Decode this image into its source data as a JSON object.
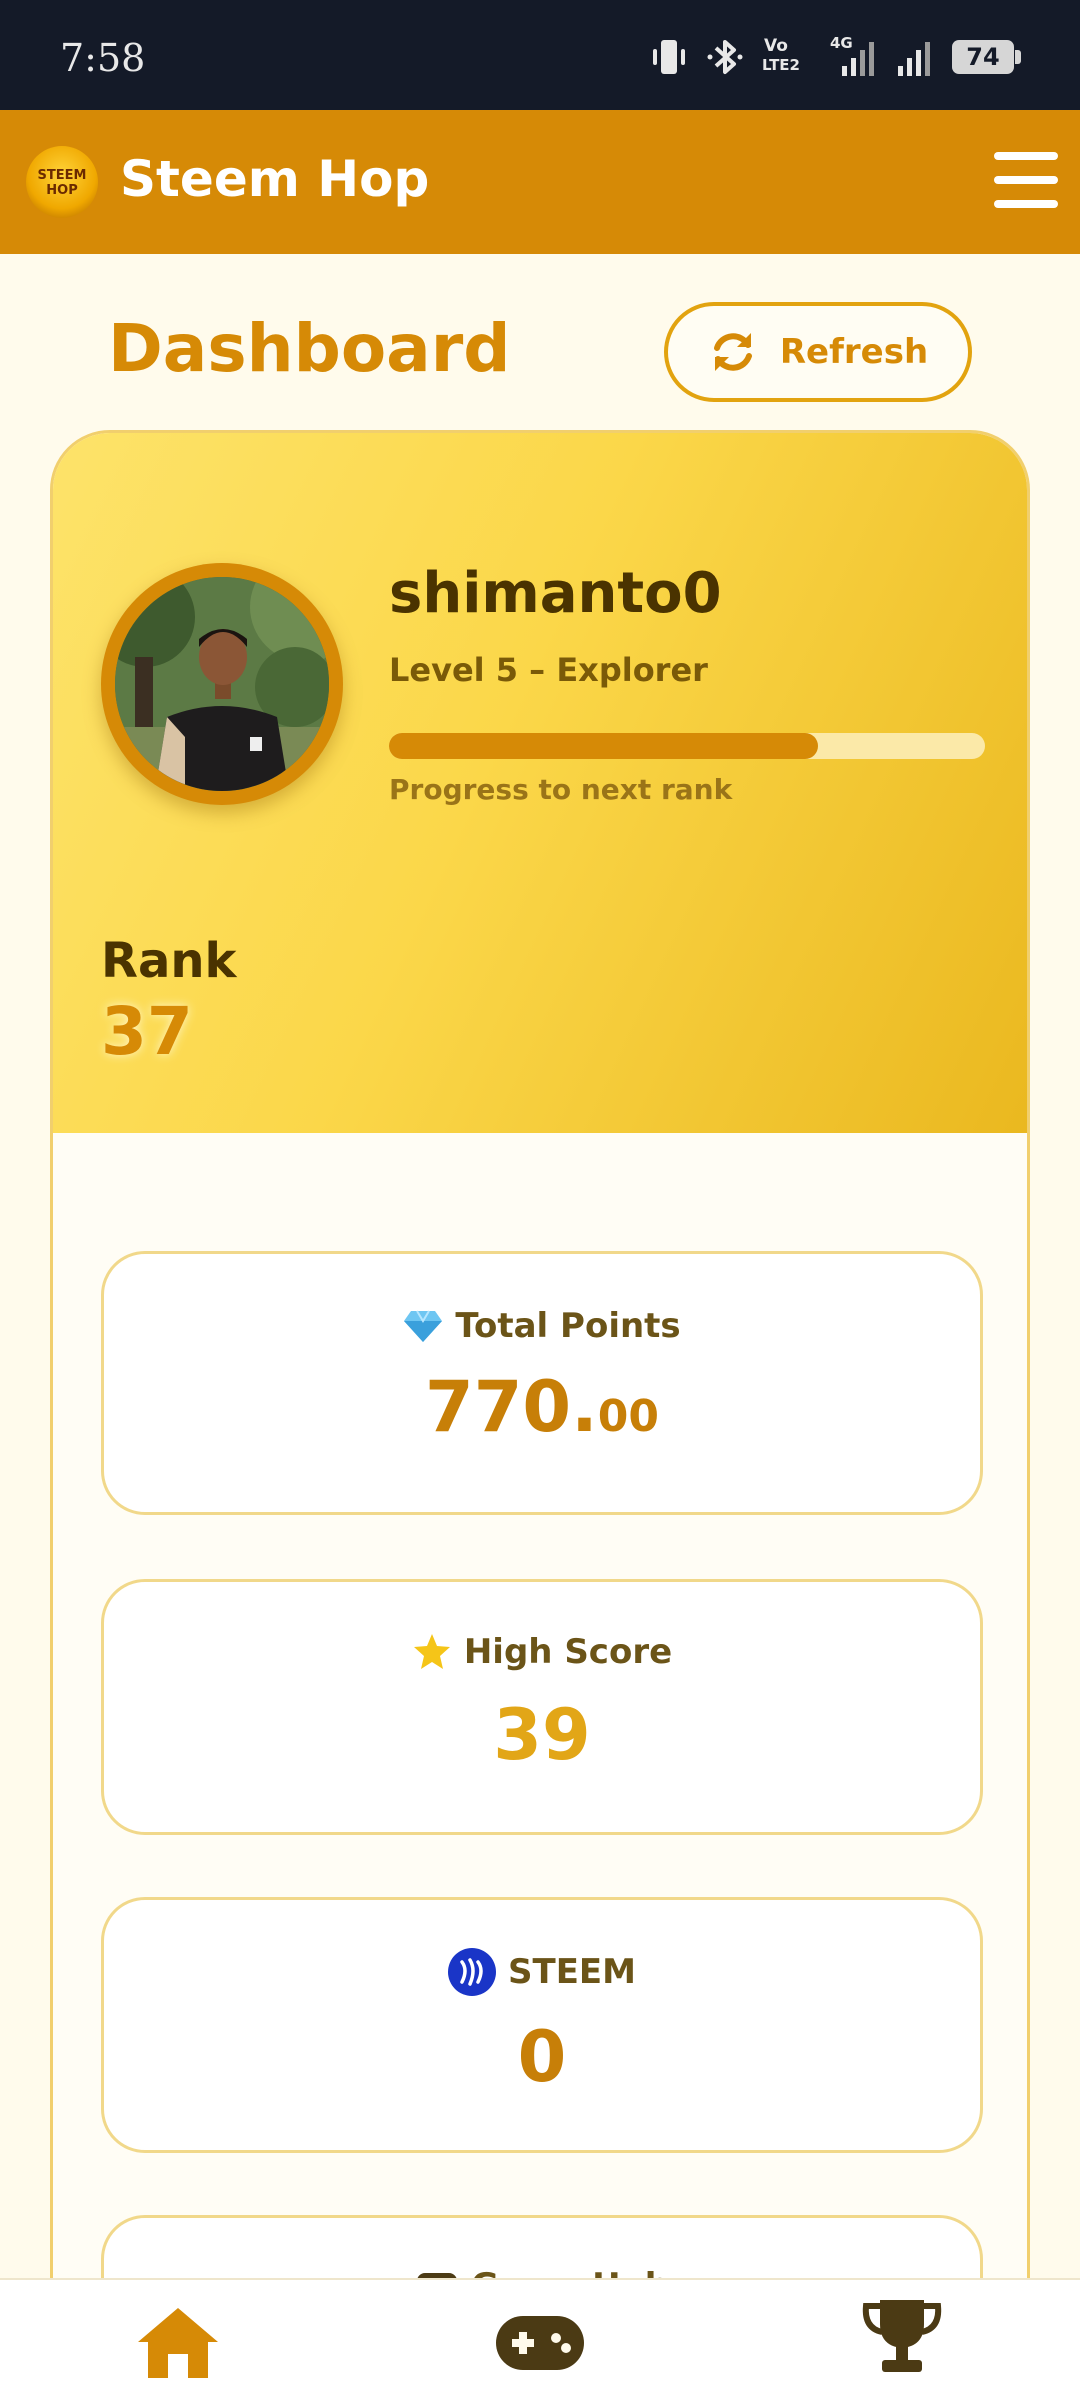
{
  "status_bar": {
    "time": "7:58",
    "network_label_volte": "Vo",
    "network_label_lte": "LTE2",
    "network_label_4g": "4G",
    "battery": "74"
  },
  "header": {
    "logo_text_1": "STEEM",
    "logo_text_2": "HOP",
    "app_title": "Steem Hop",
    "menu_icon": "hamburger-icon"
  },
  "dashboard": {
    "title": "Dashboard",
    "refresh_label": "Refresh"
  },
  "profile": {
    "username": "shimanto0",
    "level": "Level 5 – Explorer",
    "progress_to_next_rank": 0.72,
    "progress_label": "Progress to next rank",
    "rank_label": "Rank",
    "rank_value": "37"
  },
  "stats": {
    "total_points": {
      "label": "Total Points",
      "whole": "770.",
      "decimal": "00",
      "icon": "diamond-icon"
    },
    "high_score": {
      "label": "High Score",
      "value": "39",
      "icon": "star-icon"
    },
    "steem": {
      "label": "STEEM",
      "value": "0",
      "icon": "steem-logo-icon"
    },
    "partial_card_title": "Game Hub"
  },
  "colors": {
    "accent": "#d68a06",
    "header": "#d68a06",
    "dark_text": "#4a3300",
    "high_score": "#e2a617",
    "status_bar": "#141a28"
  },
  "bottom_nav": {
    "items": [
      "home-icon",
      "gamepad-icon",
      "trophy-icon"
    ]
  }
}
